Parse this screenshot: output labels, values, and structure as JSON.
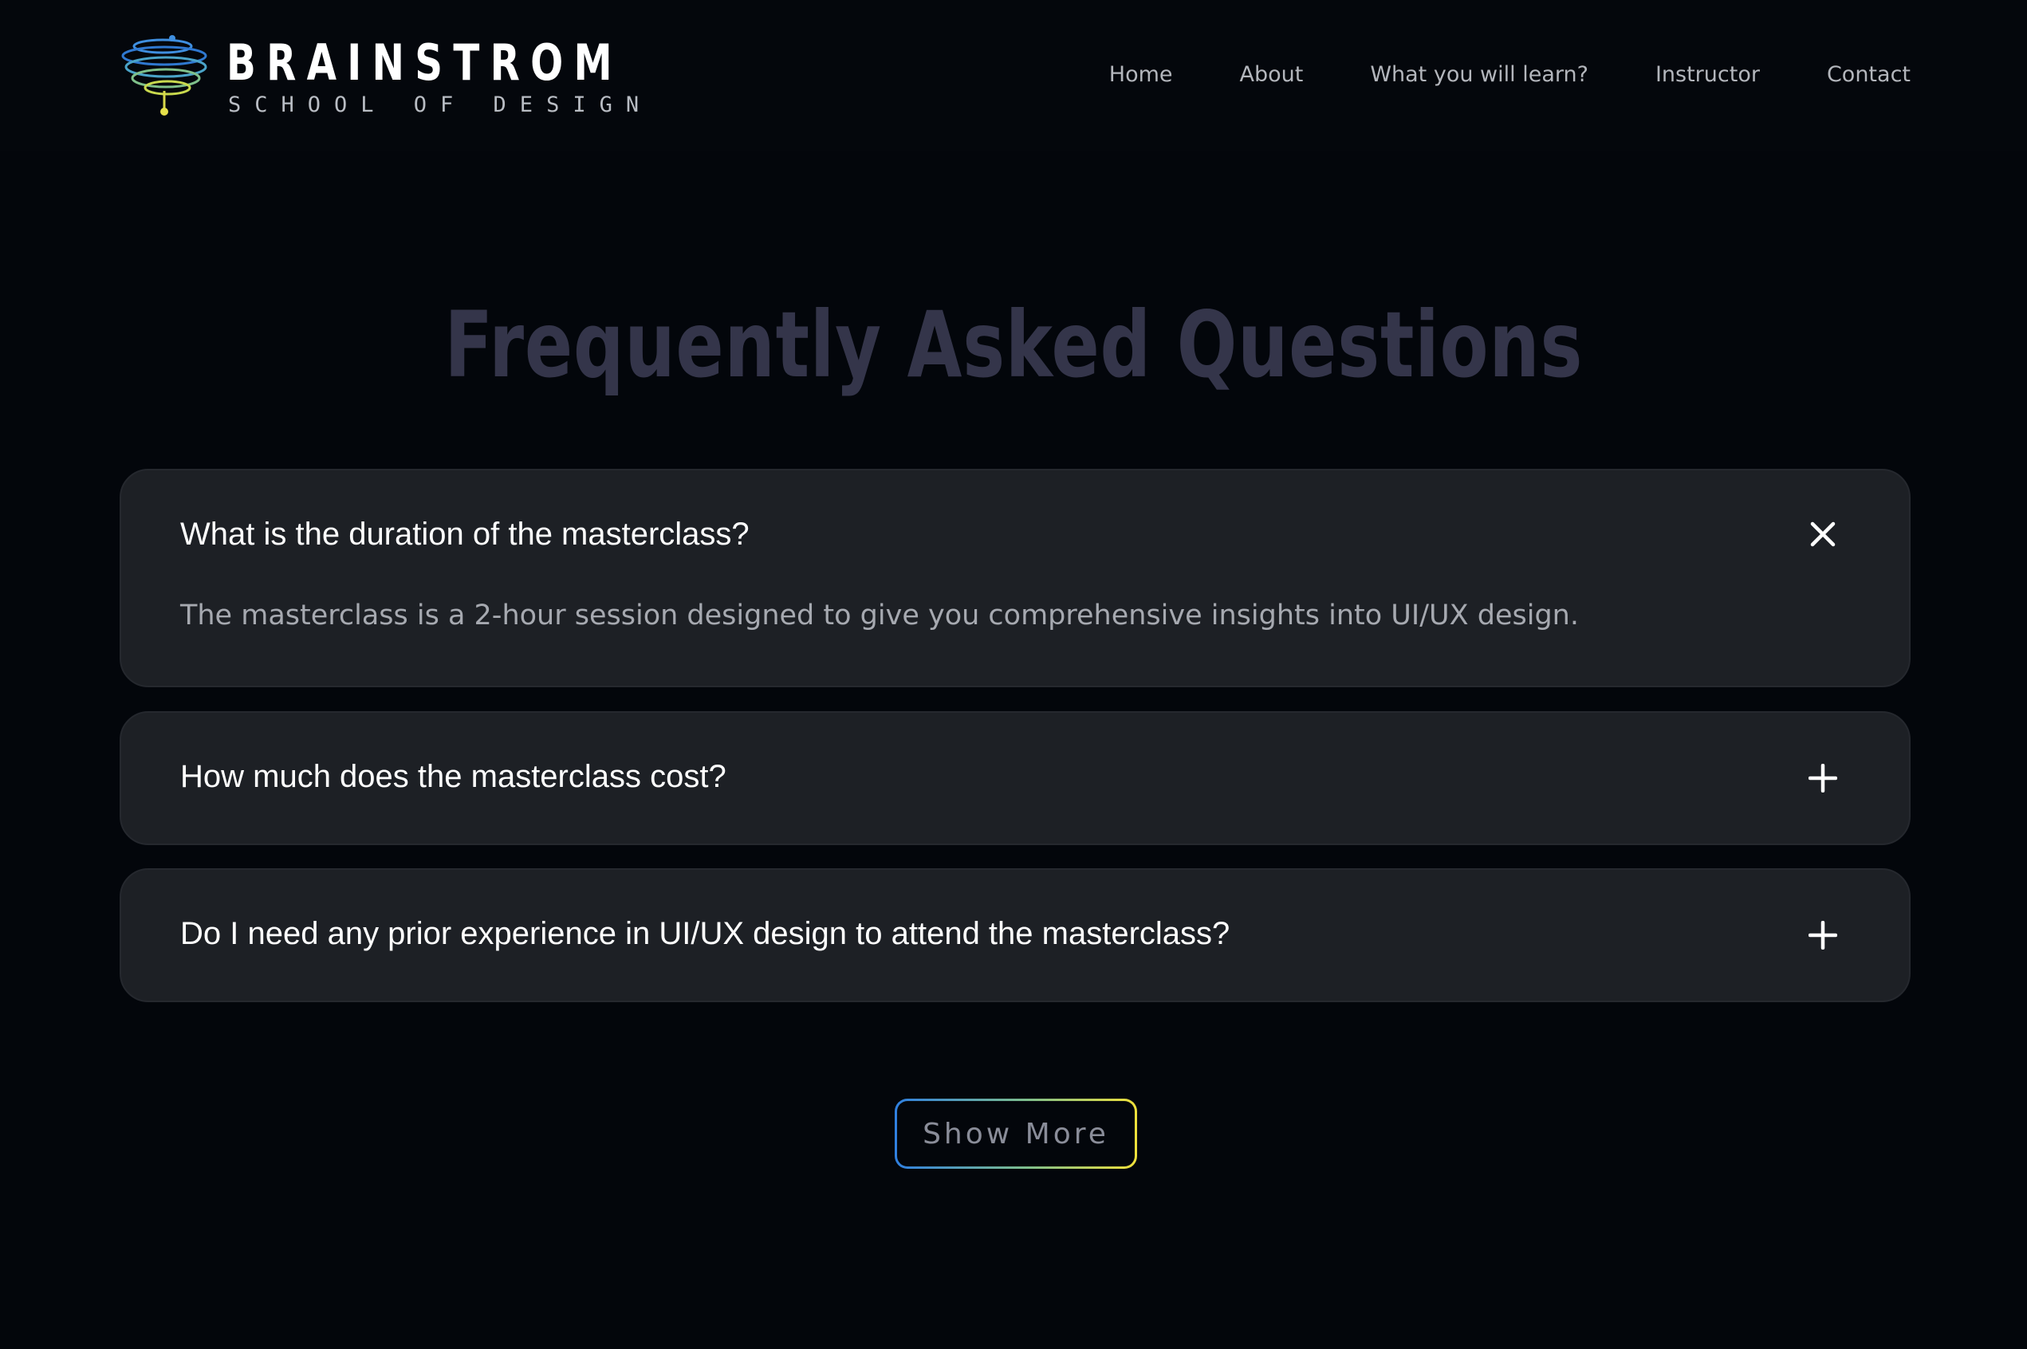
{
  "brand": {
    "name": "BRAINSTROM",
    "tagline": "SCHOOL OF DESIGN"
  },
  "nav": {
    "items": [
      {
        "label": "Home"
      },
      {
        "label": "About"
      },
      {
        "label": "What you will learn?"
      },
      {
        "label": "Instructor"
      },
      {
        "label": "Contact"
      }
    ]
  },
  "faq": {
    "title": "Frequently Asked Questions",
    "items": [
      {
        "question": "What is the duration of the masterclass?",
        "answer": "The masterclass is a 2-hour session designed to give you comprehensive insights into UI/UX design.",
        "expanded": true,
        "icon": "close-icon"
      },
      {
        "question": "How much does the masterclass cost?",
        "expanded": false,
        "icon": "plus-icon"
      },
      {
        "question": "Do I need any prior experience in UI/UX design to attend the masterclass?",
        "expanded": false,
        "icon": "plus-icon"
      }
    ],
    "show_more_label": "Show More"
  },
  "colors": {
    "background": "#03060b",
    "card": "#1d2025",
    "title": "#34354a",
    "button_gradient": [
      "#2f7fe0",
      "#f0e03a"
    ]
  }
}
